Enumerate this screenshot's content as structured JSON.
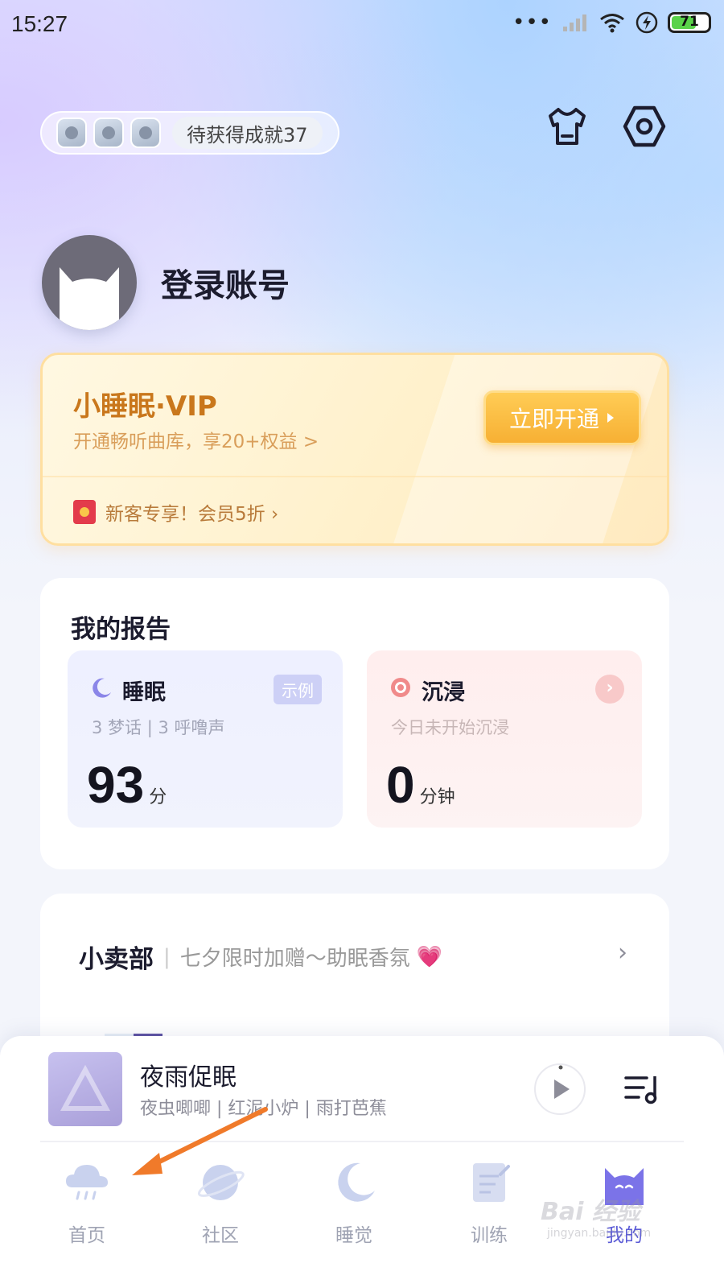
{
  "status_bar": {
    "time": "15:27",
    "dots": "•••",
    "battery_percent": 71
  },
  "achievements": {
    "label": "待获得成就37",
    "badge_count": 3
  },
  "header_icons": [
    "shirt-icon",
    "settings-icon"
  ],
  "profile": {
    "name": "登录账号"
  },
  "vip": {
    "title": "小睡眠·VIP",
    "subtitle": "开通畅听曲库，享20+权益 >",
    "button": "立即开通",
    "promo": "新客专享！会员5折 ›"
  },
  "report": {
    "title": "我的报告",
    "sleep": {
      "title": "睡眠",
      "tag": "示例",
      "sub": "3 梦话 | 3 呼噜声",
      "value": "93",
      "unit": "分"
    },
    "immerse": {
      "title": "沉浸",
      "sub": "今日未开始沉浸",
      "value": "0",
      "unit": "分钟"
    }
  },
  "shop": {
    "title": "小卖部",
    "separator": "|",
    "subtitle": "七夕限时加赠～助眠香氛",
    "emoji": "💗",
    "chevron": "›"
  },
  "player": {
    "title": "夜雨促眠",
    "subtitle": "夜虫唧唧 | 红泥小炉 | 雨打芭蕉"
  },
  "tabs": [
    {
      "label": "首页",
      "icon": "cloud-rain-icon"
    },
    {
      "label": "社区",
      "icon": "planet-icon"
    },
    {
      "label": "睡觉",
      "icon": "moon-icon"
    },
    {
      "label": "训练",
      "icon": "notepad-icon"
    },
    {
      "label": "我的",
      "icon": "cat-icon",
      "active": true
    }
  ],
  "watermark": {
    "text": "Bai 经验",
    "sub": "jingyan.baidu.com"
  },
  "colors": {
    "accent": "#5b5bd6",
    "vip_orange": "#c9771c",
    "vip_button": "#f7b034",
    "annotation_arrow": "#f07a2a"
  }
}
